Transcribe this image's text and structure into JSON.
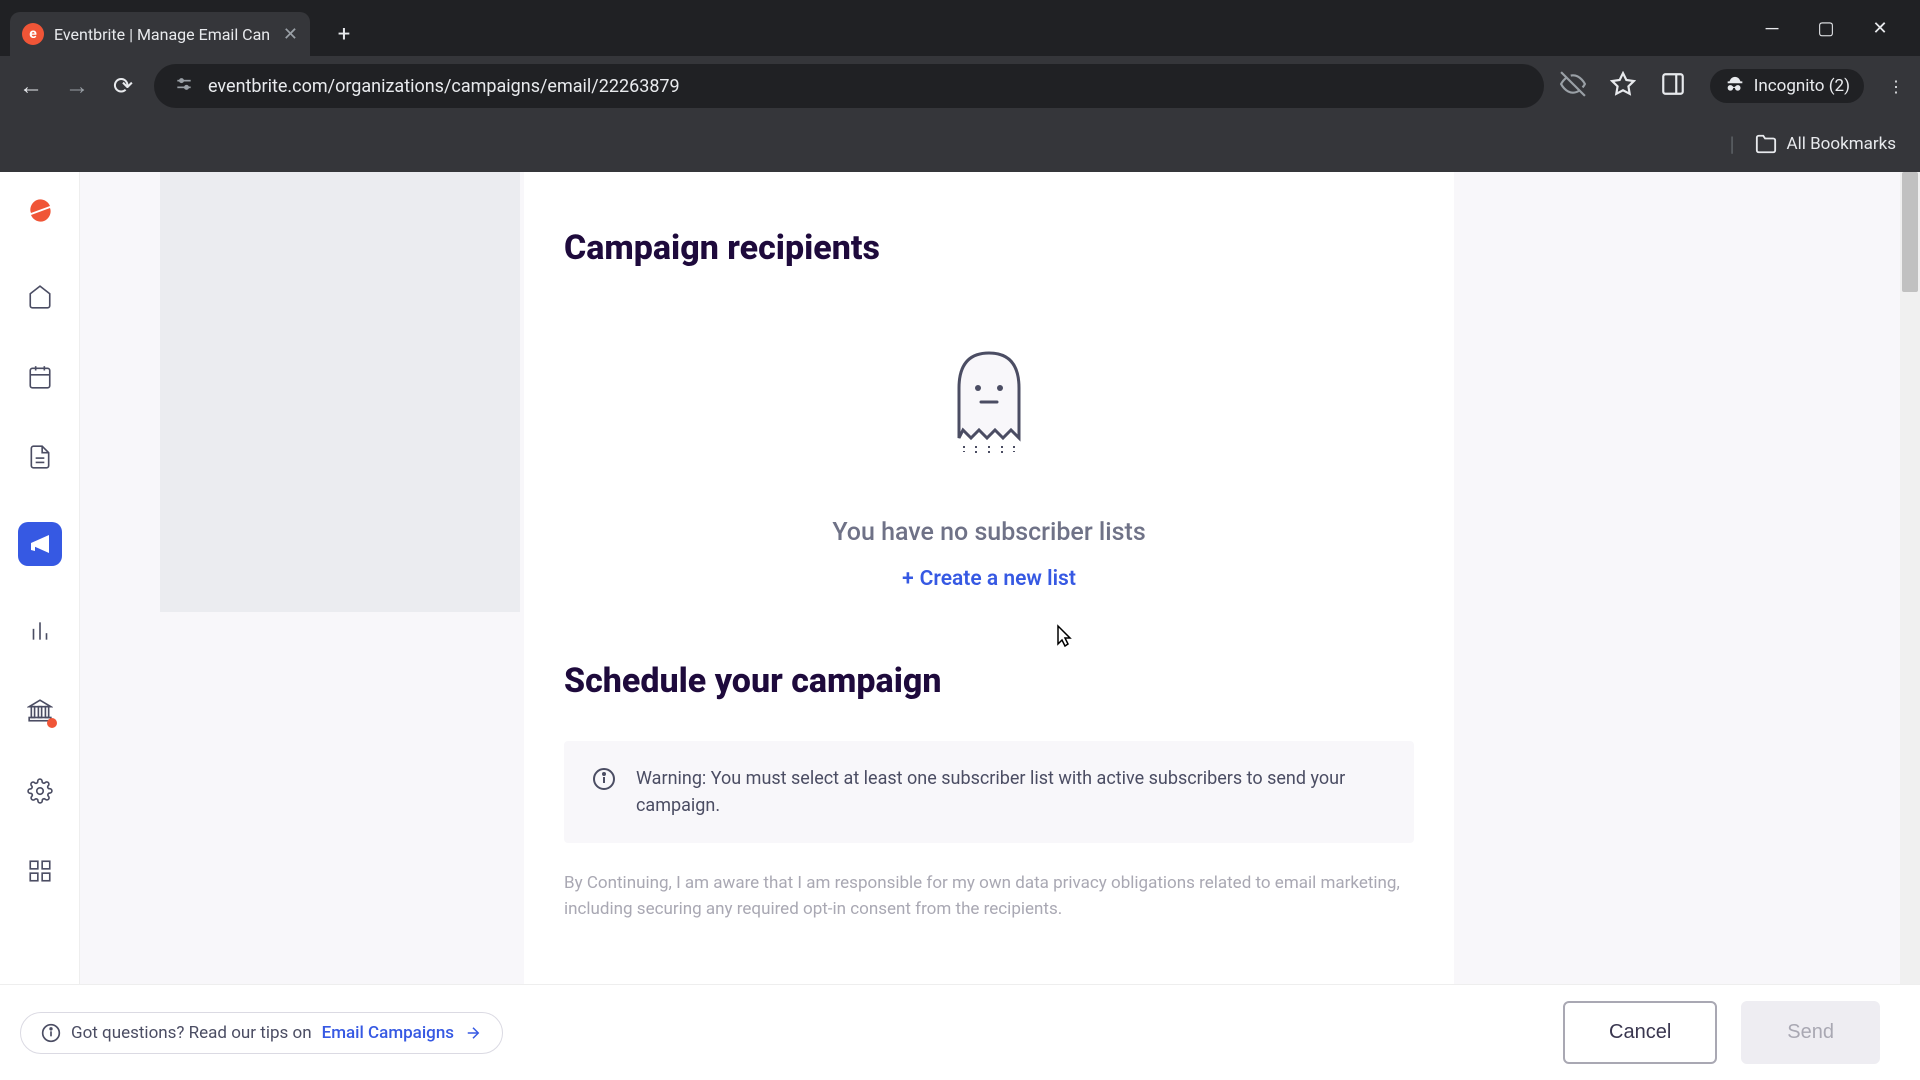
{
  "browser": {
    "tab_title": "Eventbrite | Manage Email Can",
    "url": "eventbrite.com/organizations/campaigns/email/22263879",
    "incognito_label": "Incognito (2)",
    "bookmarks_label": "All Bookmarks"
  },
  "sidebar": {
    "logo_letter": "e",
    "icons": [
      {
        "name": "home-icon"
      },
      {
        "name": "calendar-icon"
      },
      {
        "name": "document-icon"
      },
      {
        "name": "megaphone-icon",
        "active": true
      },
      {
        "name": "chart-icon"
      },
      {
        "name": "bank-icon",
        "dot": true
      },
      {
        "name": "gear-icon"
      },
      {
        "name": "apps-icon"
      }
    ],
    "help_icon": "help-icon"
  },
  "main": {
    "recipients_title": "Campaign recipients",
    "empty_text": "You have no subscriber lists",
    "create_link": "Create a new list",
    "schedule_title": "Schedule your campaign",
    "warning_text": "Warning: You must select at least one subscriber list with active subscribers to send your campaign.",
    "disclaimer": "By Continuing, I am aware that I am responsible for my own data privacy obligations related to email marketing, including securing any required opt-in consent from the recipients."
  },
  "footer": {
    "help_prefix": "Got questions? Read our tips on ",
    "help_link": "Email Campaigns",
    "cancel": "Cancel",
    "send": "Send"
  }
}
